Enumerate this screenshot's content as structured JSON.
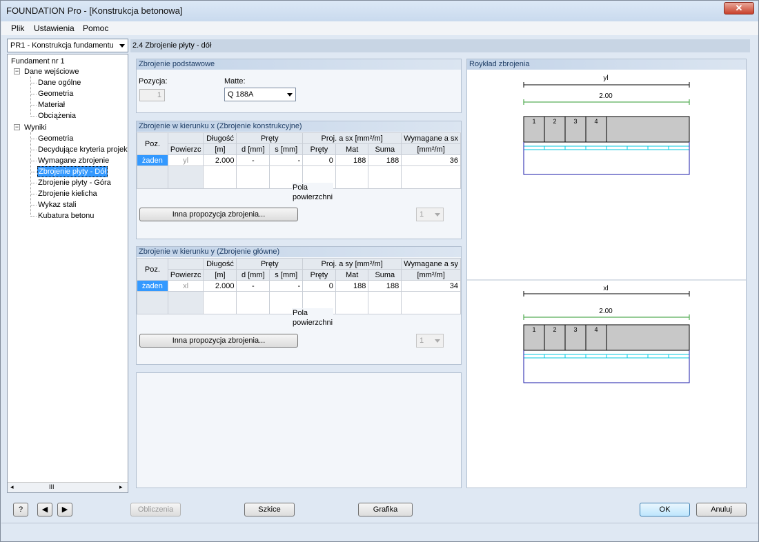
{
  "window": {
    "title": "FOUNDATION Pro - [Konstrukcja betonowa]",
    "close": "✕"
  },
  "menu": [
    "Plik",
    "Ustawienia",
    "Pomoc"
  ],
  "case_select": "PR1 - Konstrukcja fundamentu",
  "tree": {
    "root": "Fundament nr 1",
    "input_group": "Dane wejściowe",
    "input_items": [
      "Dane ogólne",
      "Geometria",
      "Materiał",
      "Obciążenia"
    ],
    "results_group": "Wyniki",
    "results_items": [
      "Geometria",
      "Decydujące kryteria projekt",
      "Wymagane zbrojenie",
      "Zbrojenie płyty - Dół",
      "Zbrojenie płyty - Góra",
      "Zbrojenie kielicha",
      "Wykaz stali",
      "Kubatura betonu"
    ],
    "scroll_thumb": "III"
  },
  "page_title": "2.4 Zbrojenie płyty - dół",
  "basic": {
    "title": "Zbrojenie podstawowe",
    "position_label": "Pozycja:",
    "position_value": "1",
    "mat_label": "Matte:",
    "mat_value": "Q 188A"
  },
  "table_headers": {
    "poz": "Poz.",
    "surface": "Powierzc",
    "length": "Długość",
    "length_unit": "[m]",
    "bars": "Pręty",
    "d": "d [mm]",
    "s": "s [mm]",
    "proj_bars": "Pręty",
    "mat": "Mat",
    "sum": "Suma",
    "req_unit": "[mm²/m]"
  },
  "dir_x": {
    "title": "Zbrojenie w kierunku x (Zbrojenie konstrukcyjne)",
    "proj_header": "Proj. a sx [mm²/m]",
    "req_header": "Wymagane a sx",
    "row": {
      "poz": "żaden",
      "surface": "yl",
      "length": "2.000",
      "d": "-",
      "s": "-",
      "bars": "0",
      "mat": "188",
      "sum": "188",
      "req": "36"
    },
    "surface_area_label": "Pola powierzchni",
    "other_button": "Inna propozycja zbrojenia...",
    "count": "1"
  },
  "dir_y": {
    "title": "Zbrojenie w kierunku y (Zbrojenie główne)",
    "proj_header": "Proj. a sy [mm²/m]",
    "req_header": "Wymagane a sy",
    "row": {
      "poz": "żaden",
      "surface": "xl",
      "length": "2.000",
      "d": "-",
      "s": "-",
      "bars": "0",
      "mat": "188",
      "sum": "188",
      "req": "34"
    },
    "surface_area_label": "Pola powierzchni",
    "other_button": "Inna propozycja zbrojenia...",
    "count": "1"
  },
  "layout_panel": {
    "title": "Roykład zbrojenia",
    "top": {
      "dim_label": "yl",
      "length": "2.00",
      "cells": [
        "1",
        "2",
        "3",
        "4"
      ]
    },
    "bottom": {
      "dim_label": "xl",
      "length": "2.00",
      "cells": [
        "1",
        "2",
        "3",
        "4"
      ]
    }
  },
  "buttons": {
    "calc": "Obliczenia",
    "sketch": "Szkice",
    "graphics": "Grafika",
    "ok": "OK",
    "cancel": "Anuluj"
  },
  "icons": {
    "help": "?",
    "prev": "◀",
    "next": "▶"
  }
}
